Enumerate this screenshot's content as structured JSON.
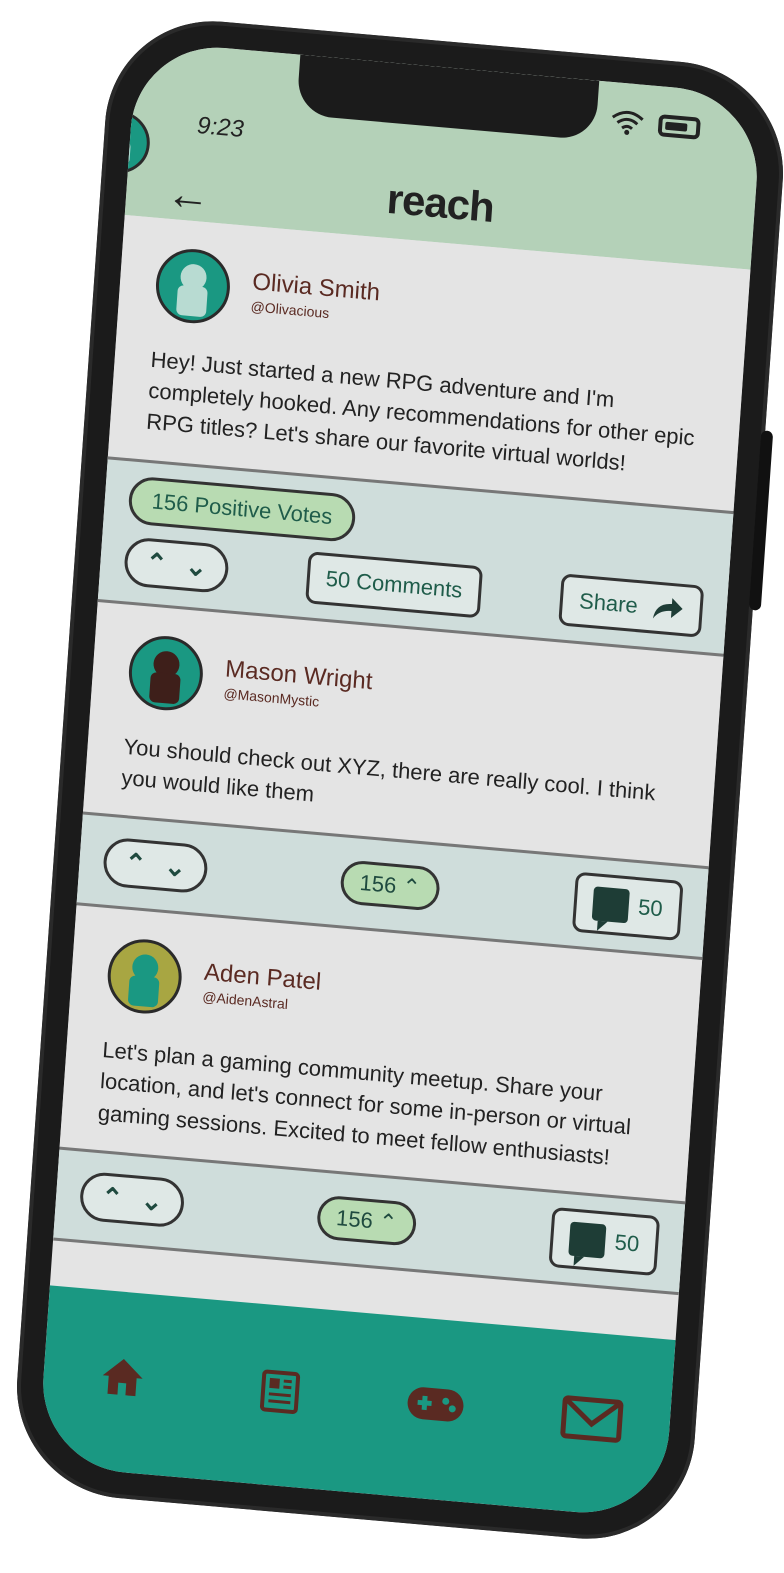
{
  "status": {
    "time": "9:23"
  },
  "header": {
    "title": "reach"
  },
  "posts": [
    {
      "name": "Olivia Smith",
      "handle": "@Olivacious",
      "text": "Hey! Just started a new RPG adventure and I'm completely hooked. Any recommendations for other epic RPG titles? Let's share our favorite virtual worlds!",
      "votes_label": "156 Positive Votes",
      "comments_label": "50 Comments",
      "share_label": "Share"
    },
    {
      "name": "Mason Wright",
      "handle": "@MasonMystic",
      "text": "You should check out XYZ, there are really cool. I think you would like them",
      "votes": "156",
      "comments": "50"
    },
    {
      "name": "Aden Patel",
      "handle": "@AidenAstral",
      "text": "Let's plan a gaming community meetup. Share your location, and let's connect for some in-person or virtual gaming sessions. Excited to meet fellow enthusiasts!",
      "votes": "156",
      "comments": "50"
    }
  ],
  "colors": {
    "header_bg": "#b4d1b8",
    "tabbar_bg": "#1a9882",
    "avatar_teal": "#1a9882",
    "avatar_olive": "#a8a642",
    "icon_brown": "#5a2a22"
  },
  "tabs": [
    "home-icon",
    "news-icon",
    "gamepad-icon",
    "mail-icon"
  ]
}
